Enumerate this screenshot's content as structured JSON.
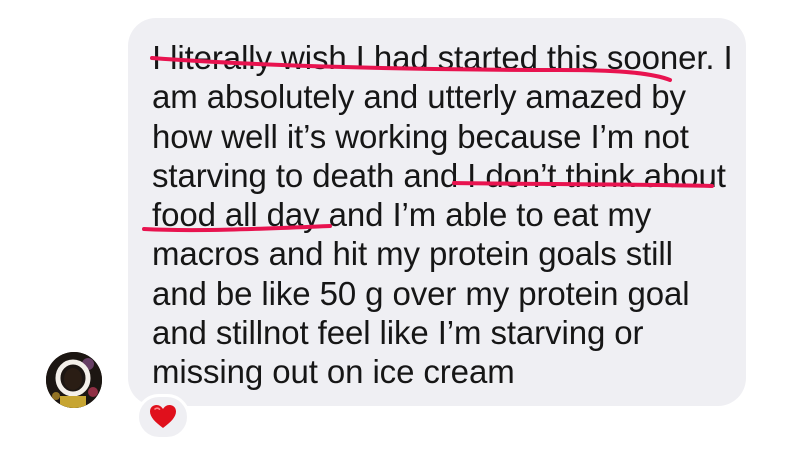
{
  "message": {
    "lines": [
      "I literally wish I had started this sooner. I",
      "am absolutely and utterly amazed by",
      "how well it’s working because I’m not",
      "starving to death and I don’t think about",
      "food all day and I’m able to eat my",
      "macros and hit my protein goals still",
      "and be like 50 g over my protein goal",
      "and stillnot feel like I’m starving or",
      "missing out on ice cream"
    ],
    "underline_color": "#e8134f",
    "bubble_color": "#efeff3"
  },
  "avatar": {
    "icon": "profile-photo"
  },
  "reaction": {
    "icon": "red-heart-icon",
    "color": "#e0101c"
  }
}
